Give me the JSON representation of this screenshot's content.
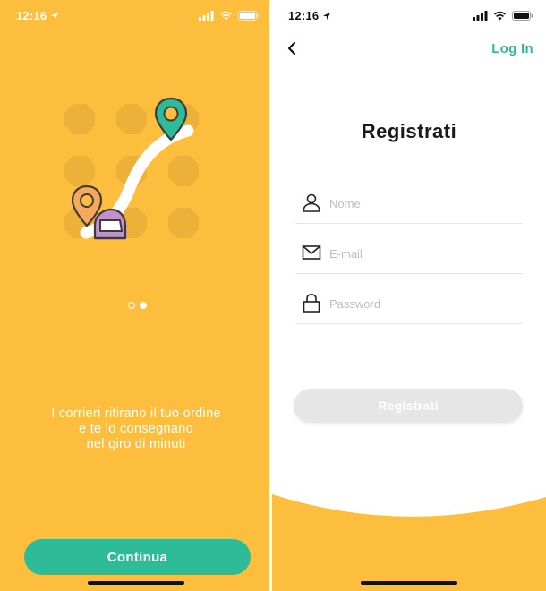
{
  "colors": {
    "primary_yellow": "#FDBE3E",
    "accent_green": "#2DBB98",
    "pin_orange": "#F6A95D",
    "helmet_purple": "#C38FCF",
    "disabled_button": "#E6E6E6"
  },
  "left_screen": {
    "status_bar": {
      "time": "12:16",
      "icons": [
        "location-arrow-icon",
        "signal-icon",
        "wifi-icon",
        "battery-icon"
      ]
    },
    "illustration": "courier-route-illustration",
    "pager": {
      "total": 2,
      "active_index": 1
    },
    "tagline": {
      "line1": "I corrieri ritirano il tuo ordine",
      "line2": "e te lo consegnano",
      "line3": "nel giro di minuti"
    },
    "continue_label": "Continua"
  },
  "right_screen": {
    "status_bar": {
      "time": "12:16",
      "icons": [
        "location-arrow-icon",
        "signal-icon",
        "wifi-icon",
        "battery-icon"
      ]
    },
    "back_icon": "chevron-left-icon",
    "login_label": "Log In",
    "title": "Registrati",
    "fields": {
      "name": {
        "placeholder": "Nome",
        "value": "",
        "icon": "user-icon"
      },
      "email": {
        "placeholder": "E-mail",
        "value": "",
        "icon": "envelope-icon"
      },
      "password": {
        "placeholder": "Password",
        "value": "",
        "icon": "lock-icon"
      }
    },
    "register_label": "Registrati"
  }
}
